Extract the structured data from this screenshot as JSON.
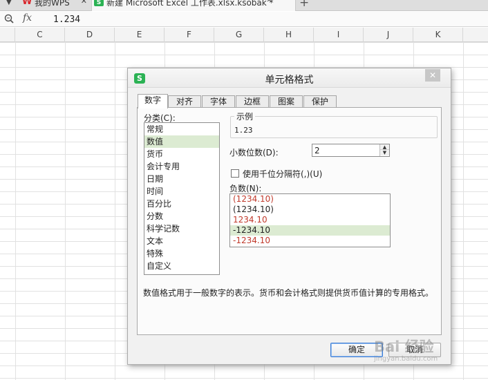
{
  "tabs": {
    "wps_label": "我的WPS",
    "doc_label": "新建 Microsoft Excel 工作表.xlsx.ksobak *"
  },
  "formula_bar": {
    "fx_label": "fx",
    "value": "1.234"
  },
  "columns": [
    "C",
    "D",
    "E",
    "F",
    "G",
    "H",
    "I",
    "J",
    "K"
  ],
  "dialog": {
    "title": "单元格格式",
    "tabs": [
      "数字",
      "对齐",
      "字体",
      "边框",
      "图案",
      "保护"
    ],
    "category_label": "分类(C):",
    "categories": [
      "常规",
      "数值",
      "货币",
      "会计专用",
      "日期",
      "时间",
      "百分比",
      "分数",
      "科学记数",
      "文本",
      "特殊",
      "自定义"
    ],
    "selected_category": "数值",
    "sample_label": "示例",
    "sample_value": "1.23",
    "decimal_label": "小数位数(D):",
    "decimal_value": "2",
    "thousands_label": "使用千位分隔符(,)(U)",
    "thousands_checked": false,
    "negative_label": "负数(N):",
    "negative_options": [
      {
        "text": "(1234.10)",
        "color": "#c0392b"
      },
      {
        "text": "(1234.10)",
        "color": "#222222"
      },
      {
        "text": "1234.10",
        "color": "#c0392b"
      },
      {
        "text": "-1234.10",
        "color": "#222222"
      },
      {
        "text": "-1234.10",
        "color": "#c0392b"
      }
    ],
    "selected_negative_index": 3,
    "description": "数值格式用于一般数字的表示。货币和会计格式则提供货币值计算的专用格式。",
    "ok_label": "确定",
    "cancel_label": "取消"
  },
  "watermark": {
    "brand": "Bai 经验",
    "url": "jingyan.baidu.com"
  },
  "colors": {
    "selection": "#dcebd2",
    "accent_green": "#2bb254",
    "ok_border": "#3a7bd5"
  }
}
